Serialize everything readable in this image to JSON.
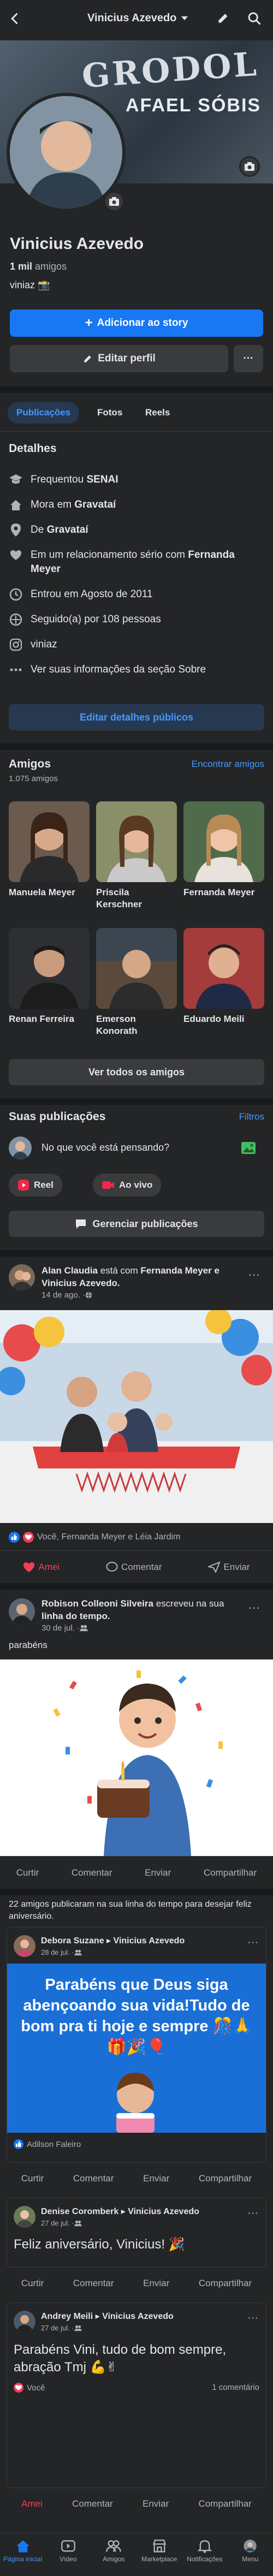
{
  "header": {
    "name": "Vinicius Azevedo"
  },
  "cover": {
    "text_line1": "GRODOL",
    "text_line2": "AFAEL SÓBIS"
  },
  "profile": {
    "name": "Vinicius Azevedo",
    "friends_count": "1 mil",
    "friends_word": "amigos",
    "bio": "viniaz 📸",
    "add_story": "Adicionar ao story",
    "edit_profile": "Editar perfil",
    "more": "···"
  },
  "tabs": [
    {
      "label": "Publicações"
    },
    {
      "label": "Fotos"
    },
    {
      "label": "Reels"
    }
  ],
  "details": {
    "title": "Detalhes",
    "items": [
      {
        "pre": "Frequentou ",
        "bold": "SENAI",
        "post": ""
      },
      {
        "pre": "Mora em ",
        "bold": "Gravataí",
        "post": ""
      },
      {
        "pre": "De ",
        "bold": "Gravataí",
        "post": ""
      },
      {
        "pre": "Em um relacionamento sério com ",
        "bold": "Fernanda Meyer",
        "post": ""
      },
      {
        "pre": "Entrou em Agosto de 2011",
        "bold": "",
        "post": ""
      },
      {
        "pre": "Seguido(a) por 108 pessoas",
        "bold": "",
        "post": ""
      },
      {
        "pre": "viniaz",
        "bold": "",
        "post": ""
      },
      {
        "pre": "Ver suas informações da seção Sobre",
        "bold": "",
        "post": ""
      }
    ],
    "edit_button": "Editar detalhes públicos"
  },
  "friends": {
    "title": "Amigos",
    "count": "1.075 amigos",
    "find": "Encontrar amigos",
    "list": [
      {
        "name": "Manuela Meyer"
      },
      {
        "name": "Priscila Kerschner"
      },
      {
        "name": "Fernanda Meyer"
      },
      {
        "name": "Renan Ferreira"
      },
      {
        "name": "Emerson Konorath"
      },
      {
        "name": "Eduardo Meili"
      }
    ],
    "see_all": "Ver todos os amigos"
  },
  "composer": {
    "title": "Suas publicações",
    "filters": "Filtros",
    "prompt": "No que você está pensando?",
    "reel": "Reel",
    "live": "Ao vivo",
    "manage": "Gerenciar publicações"
  },
  "post1": {
    "author": "Alan Claudia",
    "with_text": " está com ",
    "with_bold": "Fernanda Meyer e Vinicius Azevedo.",
    "time": "14 de ago. · ",
    "reactions": "Você, Fernanda Meyer e Léia Jardim",
    "like": "Amei",
    "comment": "Comentar",
    "send": "Enviar"
  },
  "post2": {
    "author": "Robison Colleoni Silveira",
    "middle": " escreveu na sua ",
    "bold2": "linha do tempo.",
    "time": "30 de jul. · ",
    "text": "parabéns",
    "actions": [
      "Curtir",
      "Comentar",
      "Enviar",
      "Compartilhar"
    ]
  },
  "group": {
    "text": "22 amigos publicaram na sua linha do tempo para desejar feliz aniversário.",
    "post_a": {
      "author": "Debora Suzane",
      "arrow": " ▸ ",
      "target": "Vinicius Azevedo",
      "time": "28 de jul. · ",
      "image_text": "Parabéns que Deus siga abençoando sua vida!Tudo de bom pra ti hoje e sempre 🎊🙏🎁🎉🎈",
      "reactions": "Adilson Faleiro"
    },
    "post_b": {
      "author": "Denise Coromberk",
      "arrow": " ▸ ",
      "target": "Vinicius Azevedo",
      "time": "27 de jul. · ",
      "text": "Feliz aniversário, Vinicius! 🎉"
    },
    "post_c": {
      "author": "Andrey Meili",
      "arrow": " ▸ ",
      "target": "Vinicius Azevedo",
      "time": "27 de jul. · ",
      "text": "Parabéns Vini, tudo de bom sempre, abração Tmj 💪✌",
      "reactions": "Você",
      "comments": "1 comentário",
      "actions": [
        "Amei",
        "Comentar",
        "Enviar",
        "Compartilhar"
      ]
    },
    "actions": [
      "Curtir",
      "Comentar",
      "Enviar",
      "Compartilhar"
    ]
  },
  "nav": [
    {
      "label": "Página inicial"
    },
    {
      "label": "Vídeo"
    },
    {
      "label": "Amigos"
    },
    {
      "label": "Marketplace"
    },
    {
      "label": "Notificações"
    },
    {
      "label": "Menu"
    }
  ],
  "colors": {
    "accent": "#1877f2",
    "bg": "#242526",
    "sep": "#18191a",
    "love": "#f33e58",
    "link": "#4599ff"
  }
}
